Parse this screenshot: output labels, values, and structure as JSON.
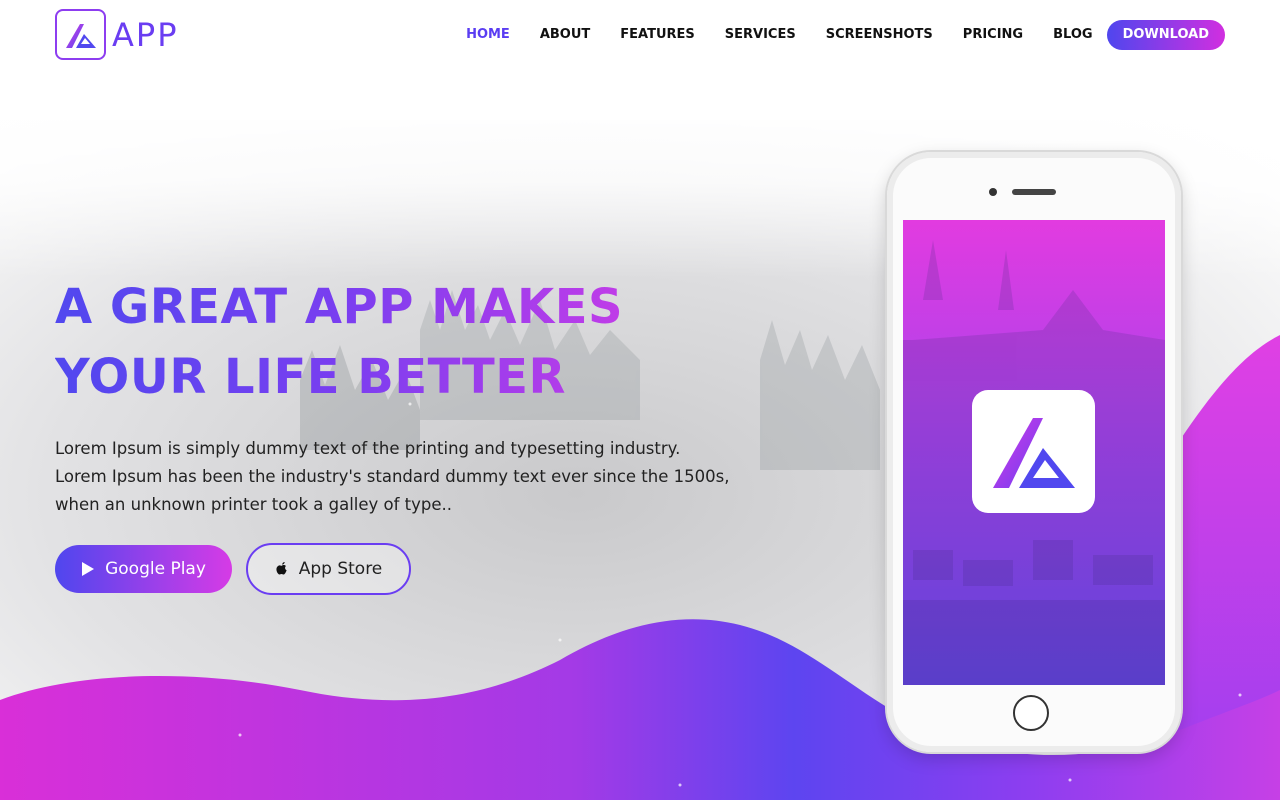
{
  "brand": {
    "name": "APP",
    "logo_icon": "app-logo-icon"
  },
  "nav": {
    "items": [
      {
        "label": "HOME",
        "active": true
      },
      {
        "label": "ABOUT"
      },
      {
        "label": "FEATURES"
      },
      {
        "label": "SERVICES"
      },
      {
        "label": "SCREENSHOTS"
      },
      {
        "label": "PRICING"
      },
      {
        "label": "BLOG"
      }
    ],
    "download_label": "DOWNLOAD"
  },
  "hero": {
    "headline_line1": "A GREAT APP MAKES",
    "headline_line2": "YOUR LIFE BETTER",
    "description": "Lorem Ipsum is simply dummy text of the printing and typesetting industry. Lorem Ipsum has been the industry's standard dummy text ever since the 1500s, when an unknown printer took a galley of type..",
    "buttons": {
      "google_play": "Google Play",
      "app_store": "App Store"
    }
  },
  "colors": {
    "accent_blue": "#5148ef",
    "accent_purple": "#7a3ef0",
    "accent_pink": "#d23ce6",
    "text_dark": "#111111"
  },
  "icons": {
    "play": "play-icon",
    "apple": "apple-icon",
    "app": "app-logo-icon"
  }
}
